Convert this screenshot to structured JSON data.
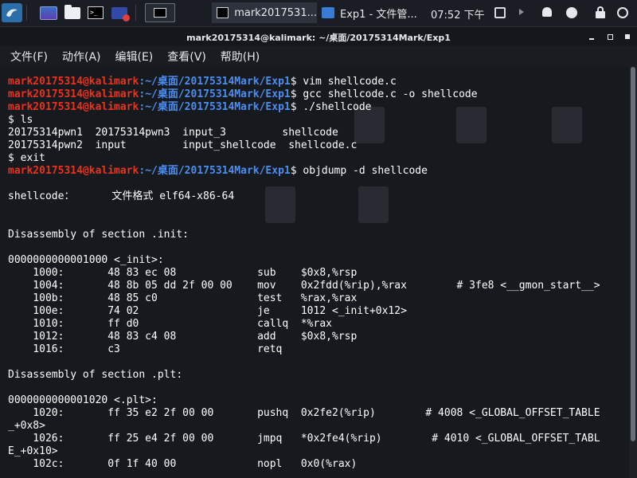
{
  "panel": {
    "tasks": [
      {
        "label": "mark2017531..."
      },
      {
        "label": "Exp1 - 文件管..."
      }
    ],
    "clock": "07:52 下午"
  },
  "window": {
    "title": "mark20175314@kalimark: ~/桌面/20175314Mark/Exp1",
    "menu": [
      "文件(F)",
      "动作(A)",
      "编辑(E)",
      "查看(V)",
      "帮助(H)"
    ]
  },
  "terminal": {
    "user_host": "mark20175314@kalimark",
    "path": ":~/桌面/20175314Mark/Exp1",
    "commands": [
      "vim shellcode.c",
      "gcc shellcode.c -o shellcode",
      "./shellcode"
    ],
    "ls_prompt": "$ ls",
    "ls_line1": "20175314pwn1  20175314pwn3  input_3         shellcode",
    "ls_line2": "20175314pwn2  input         input_shellcode  shellcode.c",
    "exit_line": "$ exit",
    "objdump_cmd": "objdump -d shellcode",
    "file_format": "shellcode：      文件格式 elf64-x86-64",
    "sec_init": "Disassembly of section .init:",
    "init_label": "0000000000001000 <_init>:",
    "init_rows": [
      "    1000:       48 83 ec 08             sub    $0x8,%rsp",
      "    1004:       48 8b 05 dd 2f 00 00    mov    0x2fdd(%rip),%rax        # 3fe8 <__gmon_start__>",
      "    100b:       48 85 c0                test   %rax,%rax",
      "    100e:       74 02                   je     1012 <_init+0x12>",
      "    1010:       ff d0                   callq  *%rax",
      "    1012:       48 83 c4 08             add    $0x8,%rsp",
      "    1016:       c3                      retq"
    ],
    "sec_plt": "Disassembly of section .plt:",
    "plt_label": "0000000000001020 <.plt>:",
    "plt_rows": [
      "    1020:       ff 35 e2 2f 00 00       pushq  0x2fe2(%rip)        # 4008 <_GLOBAL_OFFSET_TABLE",
      "_+0x8>",
      "    1026:       ff 25 e4 2f 00 00       jmpq   *0x2fe4(%rip)        # 4010 <_GLOBAL_OFFSET_TABL",
      "E_+0x10>",
      "    102c:       0f 1f 40 00             nopl   0x0(%rax)"
    ]
  }
}
